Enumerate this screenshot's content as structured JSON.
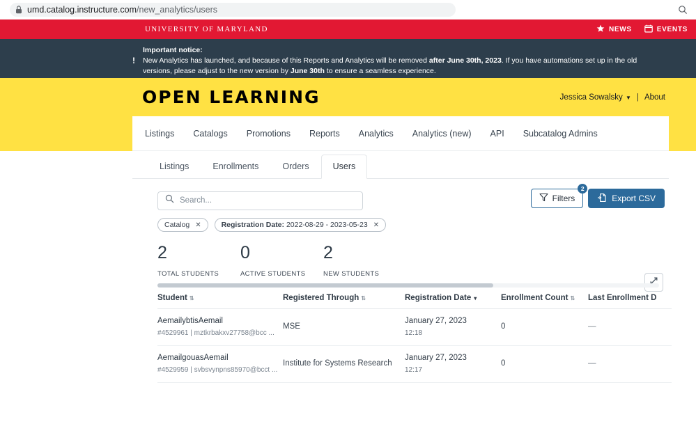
{
  "browser": {
    "url_host": "umd.catalog.instructure.com",
    "url_path": "/new_analytics/users",
    "lock_icon": "lock-icon",
    "search_icon": "search-icon"
  },
  "umd_bar": {
    "title": "UNIVERSITY OF MARYLAND",
    "links": [
      {
        "label": "NEWS",
        "icon": "star-icon"
      },
      {
        "label": "EVENTS",
        "icon": "calendar-icon"
      }
    ],
    "bg_color": "#e21833"
  },
  "notice": {
    "icon": "exclamation-icon",
    "label": "Important notice:",
    "body_1": "New Analytics has launched, and because of this Reports and Analytics will be removed ",
    "body_bold_1": "after June 30th, 2023",
    "body_2": ". If you have automations set up in the old versions, please adjust to the new version by ",
    "body_bold_2": "June 30th",
    "body_3": " to ensure a seamless experience.",
    "bg_color": "#2d3e4c"
  },
  "brand": {
    "logo": "OPEN LEARNING",
    "user_name": "Jessica Sowalsky",
    "caret_icon": "chevron-down-icon",
    "divider": "|",
    "about_label": "About",
    "bg_color": "#ffe143"
  },
  "main_nav": {
    "items": [
      "Listings",
      "Catalogs",
      "Promotions",
      "Reports",
      "Analytics",
      "Analytics (new)",
      "API",
      "Subcatalog Admins"
    ]
  },
  "tabs": [
    {
      "label": "Listings",
      "active": false
    },
    {
      "label": "Enrollments",
      "active": false
    },
    {
      "label": "Orders",
      "active": false
    },
    {
      "label": "Users",
      "active": true
    }
  ],
  "toolbar": {
    "search_placeholder": "Search...",
    "search_value": "",
    "search_icon": "search-icon",
    "filters_label": "Filters",
    "filters_icon": "funnel-icon",
    "filters_count": "2",
    "export_label": "Export CSV",
    "export_icon": "export-icon",
    "export_bg_color": "#2c6a9b",
    "expand_icon": "expand-diagonal-icon"
  },
  "chips": [
    {
      "label": "Catalog",
      "value": "",
      "close_icon": "close-icon"
    },
    {
      "label": "Registration Date:",
      "value": " 2022-08-29 - 2023-05-23",
      "close_icon": "close-icon"
    }
  ],
  "stats": [
    {
      "value": "2",
      "label": "TOTAL STUDENTS"
    },
    {
      "value": "0",
      "label": "ACTIVE STUDENTS"
    },
    {
      "value": "2",
      "label": "NEW STUDENTS"
    }
  ],
  "table": {
    "columns": [
      {
        "label": "Student",
        "sort": "both"
      },
      {
        "label": "Registered Through",
        "sort": "both"
      },
      {
        "label": "Registration Date",
        "sort": "desc"
      },
      {
        "label": "Enrollment Count",
        "sort": "both"
      },
      {
        "label": "Last Enrollment D",
        "sort": "none"
      }
    ],
    "rows": [
      {
        "student_name": "AemailybtisAemail",
        "student_sub": "#4529961 | mztkrbakxv27758@bcc ...",
        "registered_through": "MSE",
        "registration_date": "January 27, 2023",
        "registration_time": "12:18",
        "enrollment_count": "0",
        "last_enrollment": "—"
      },
      {
        "student_name": "AemailgouasAemail",
        "student_sub": "#4529959 | svbsvynpns85970@bcct ...",
        "registered_through": "Institute for Systems Research",
        "registration_date": "January 27, 2023",
        "registration_time": "12:17",
        "enrollment_count": "0",
        "last_enrollment": "—"
      }
    ]
  }
}
